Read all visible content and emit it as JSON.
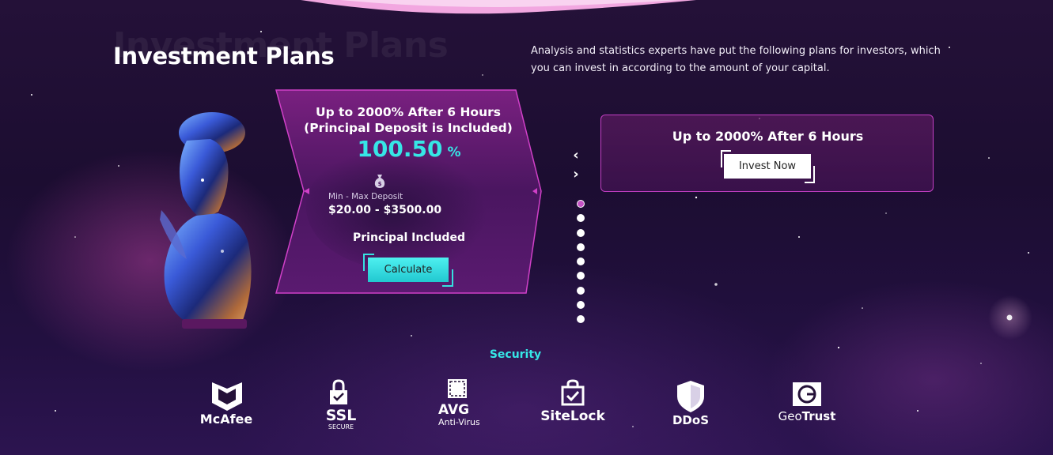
{
  "header": {
    "title": "Investment Plans",
    "ghost_title": "Investment Plans",
    "description": "Analysis and statistics experts have put the following plans for investors, which you can invest in according to the amount of your capital."
  },
  "plan_card": {
    "title": "Up to 2000% After 6 Hours (Principal Deposit is Included)",
    "rate": "100.50",
    "rate_unit": "%",
    "deposit_label": "Min - Max Deposit",
    "deposit_range": "$20.00 - $3500.00",
    "principal": "Principal Included",
    "calculate_label": "Calculate"
  },
  "carousel": {
    "prev_icon": "chevron-left-icon",
    "next_icon": "chevron-right-icon",
    "dot_count": 9,
    "active_dot": 1
  },
  "summary": {
    "title": "Up to 2000% After 6 Hours",
    "invest_label": "Invest Now"
  },
  "security": {
    "title": "Security",
    "logos": [
      {
        "name": "McAfee"
      },
      {
        "name": "SSL",
        "sub": "SECURE"
      },
      {
        "name": "AVG",
        "sub": "Anti-Virus"
      },
      {
        "name": "SiteLock"
      },
      {
        "name": "DDoS"
      },
      {
        "name": "GeoTrust",
        "prefix": "Geo",
        "suffix": "Trust"
      }
    ]
  },
  "colors": {
    "accent_cyan": "#36e6e6",
    "accent_magenta": "#c43fc4",
    "background": "#1c0d31"
  }
}
